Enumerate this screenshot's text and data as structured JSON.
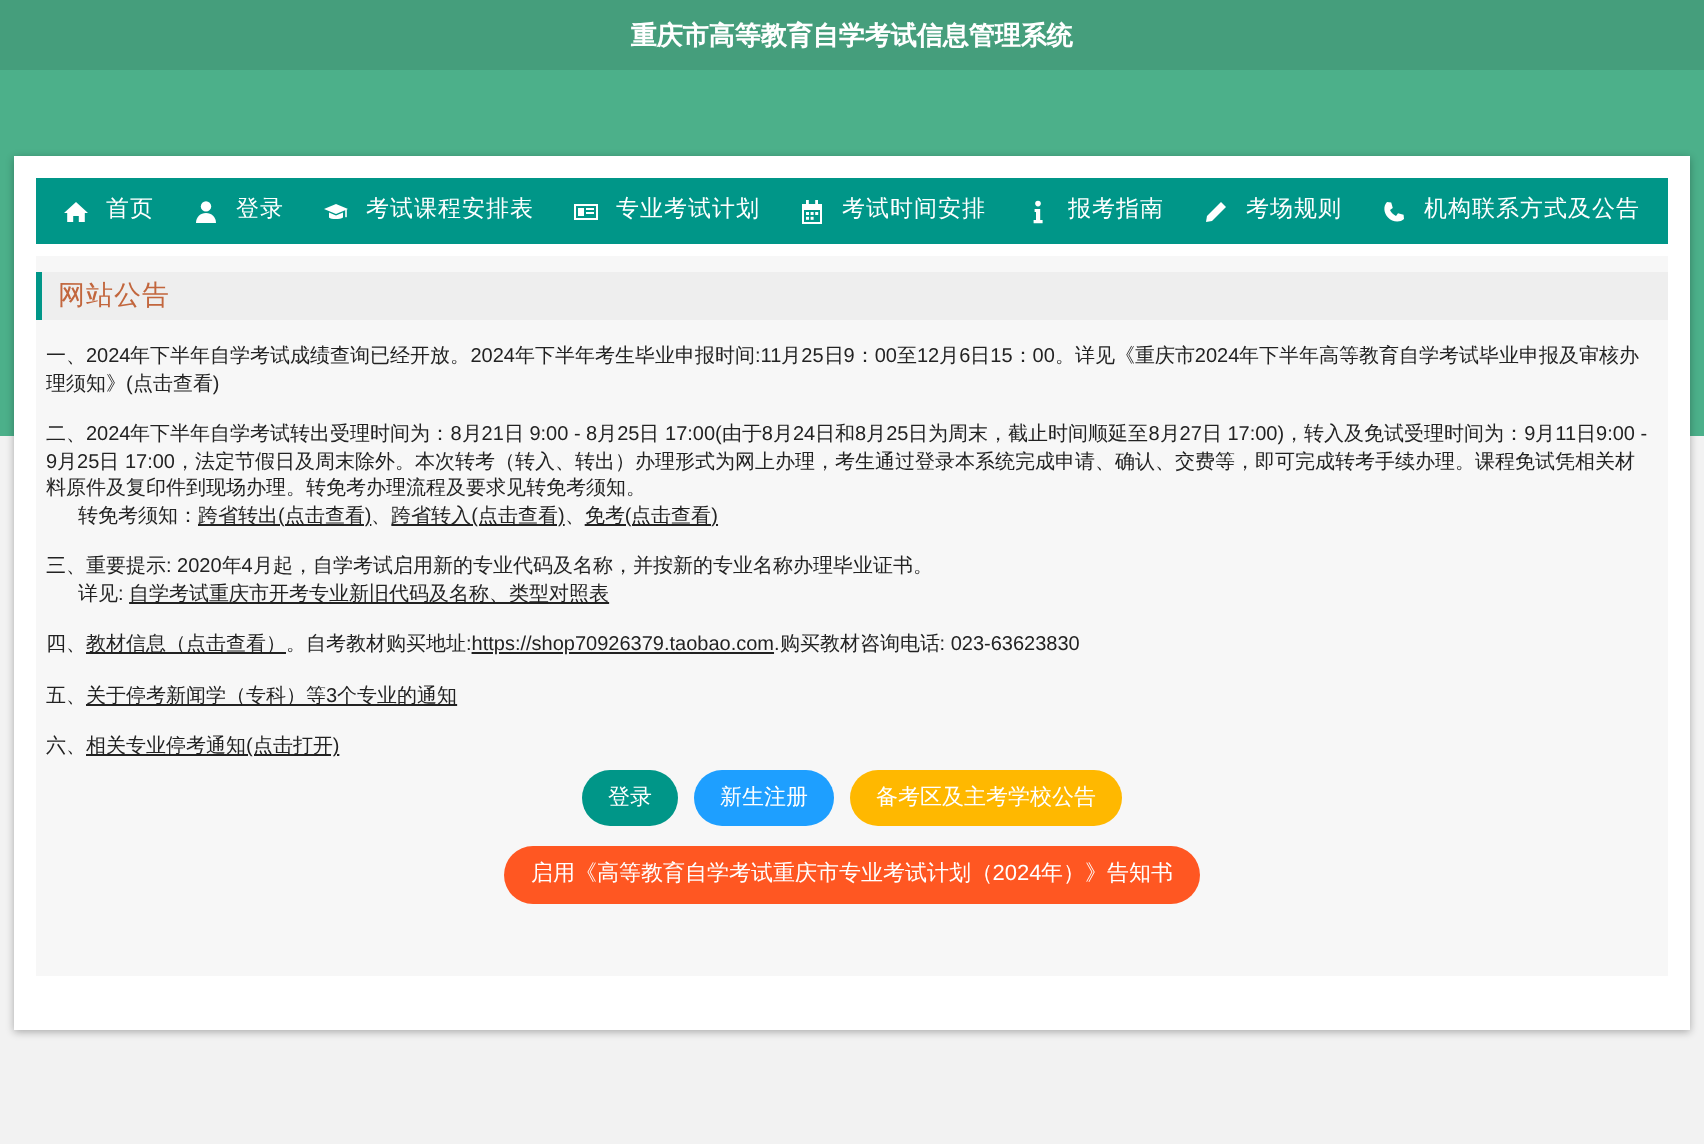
{
  "header": {
    "title": "重庆市高等教育自学考试信息管理系统"
  },
  "nav": [
    {
      "label": "首页"
    },
    {
      "label": "登录"
    },
    {
      "label": "考试课程安排表"
    },
    {
      "label": "专业考试计划"
    },
    {
      "label": "考试时间安排"
    },
    {
      "label": "报考指南"
    },
    {
      "label": "考场规则"
    },
    {
      "label": "机构联系方式及公告"
    }
  ],
  "notice_title": "网站公告",
  "notices": [
    {
      "lines": [
        [
          {
            "text": "一、2024年下半年自学考试成绩查询已经开放。2024年下半年考生毕业申报时间:11月25日9：00至12月6日15：00。详见《重庆市2024年下半年高等教育自学考试毕业申报及审核办理须知》(点击查看)",
            "link": false
          }
        ]
      ]
    },
    {
      "lines": [
        [
          {
            "text": "二、2024年下半年自学考试转出受理时间为：8月21日 9:00 - 8月25日 17:00(由于8月24日和8月25日为周末，截止时间顺延至8月27日 17:00)，转入及免试受理时间为：9月11日9:00 - 9月25日 17:00，法定节假日及周末除外。本次转考（转入、转出）办理形式为网上办理，考生通过登录本系统完成申请、确认、交费等，即可完成转考手续办理。课程免试凭相关材料原件及复印件到现场办理。转免考办理流程及要求见转免考须知。",
            "link": false
          }
        ],
        [
          {
            "text": "转免考须知：",
            "link": false
          },
          {
            "text": "跨省转出(点击查看)",
            "link": true
          },
          {
            "text": "、",
            "link": false
          },
          {
            "text": "跨省转入(点击查看)",
            "link": true
          },
          {
            "text": "、",
            "link": false
          },
          {
            "text": "免考(点击查看)",
            "link": true
          }
        ]
      ]
    },
    {
      "lines": [
        [
          {
            "text": "三、重要提示: 2020年4月起，自学考试启用新的专业代码及名称，并按新的专业名称办理毕业证书。",
            "link": false
          }
        ],
        [
          {
            "text": "详见: ",
            "link": false
          },
          {
            "text": "自学考试重庆市开考专业新旧代码及名称、类型对照表",
            "link": true
          }
        ]
      ]
    },
    {
      "lines": [
        [
          {
            "text": "四、",
            "link": false
          },
          {
            "text": "教材信息（点击查看）",
            "link": true
          },
          {
            "text": "。自考教材购买地址:",
            "link": false
          },
          {
            "text": "https://shop70926379.taobao.com",
            "link": true
          },
          {
            "text": ".购买教材咨询电话: 023-63623830",
            "link": false
          }
        ]
      ]
    },
    {
      "lines": [
        [
          {
            "text": "五、",
            "link": false
          },
          {
            "text": "关于停考新闻学（专科）等3个专业的通知",
            "link": true
          }
        ]
      ]
    },
    {
      "lines": [
        [
          {
            "text": "六、",
            "link": false
          },
          {
            "text": "相关专业停考通知(点击打开)",
            "link": true
          }
        ]
      ]
    }
  ],
  "buttons": [
    [
      {
        "label": "登录",
        "color": "#009688"
      },
      {
        "label": "新生注册",
        "color": "#1e9fff"
      },
      {
        "label": "备考区及主考学校公告",
        "color": "#ffb800"
      }
    ],
    [
      {
        "label": "启用《高等教育自学考试重庆市专业考试计划（2024年）》告知书",
        "color": "#ff5722"
      }
    ]
  ]
}
